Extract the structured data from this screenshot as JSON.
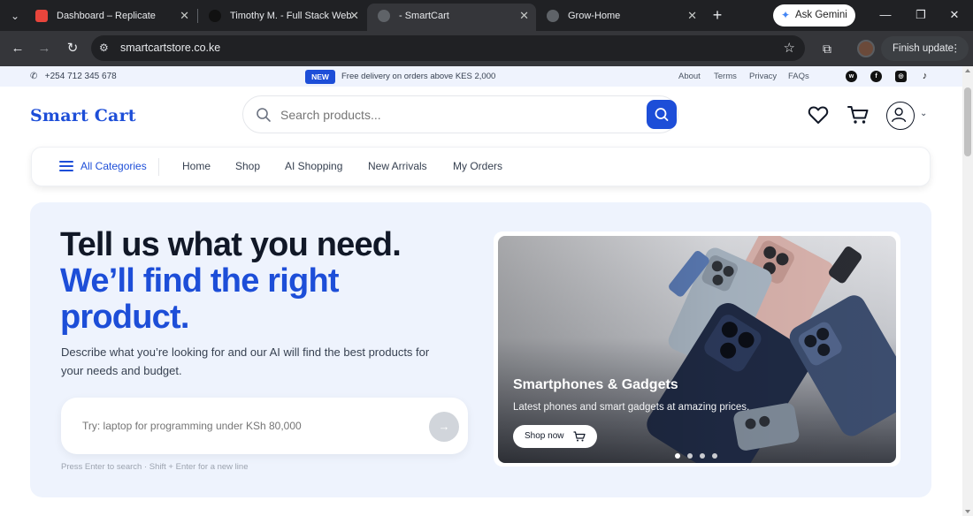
{
  "browser": {
    "tabs": [
      {
        "title": "Dashboard – Replicate",
        "favicon_color": "#e8453c"
      },
      {
        "title": "Timothy M. - Full Stack Web",
        "favicon_color": "#111111"
      },
      {
        "title": "- SmartCart",
        "favicon_color": "#5f6368"
      },
      {
        "title": "Grow-Home",
        "favicon_color": "#5f6368"
      }
    ],
    "ask_gemini": "Ask Gemini",
    "url": "smartcartstore.co.ke",
    "finish_update": "Finish update"
  },
  "top_strip": {
    "phone": "+254 712 345 678",
    "badge": "NEW",
    "promo": "Free delivery on orders above KES 2,000",
    "links": [
      "About",
      "Terms",
      "Privacy",
      "FAQs"
    ],
    "social_icons": [
      "whatsapp-icon",
      "facebook-icon",
      "instagram-icon",
      "tiktok-icon"
    ]
  },
  "header": {
    "logo": "Smart Cart",
    "search_placeholder": "Search products..."
  },
  "nav": {
    "all_categories": "All Categories",
    "items": [
      "Home",
      "Shop",
      "AI Shopping",
      "New Arrivals",
      "My Orders"
    ]
  },
  "hero": {
    "headline_line1": "Tell us what you need.",
    "headline_line2": "We’ll find the right product.",
    "subtext": "Describe what you’re looking for and our AI will find the best products for your needs and budget.",
    "ai_placeholder": "Try: laptop for programming under KSh 80,000",
    "hint": "Press Enter to search · Shift + Enter for a new line"
  },
  "banner": {
    "title": "Smartphones & Gadgets",
    "subtitle": "Latest phones and smart gadgets at amazing prices.",
    "cta": "Shop now",
    "slide_count": 4,
    "active_slide": 1
  },
  "colors": {
    "brand": "#1d4ed8",
    "hero_bg": "#eef3fd",
    "strip_bg": "#eff3fd"
  }
}
